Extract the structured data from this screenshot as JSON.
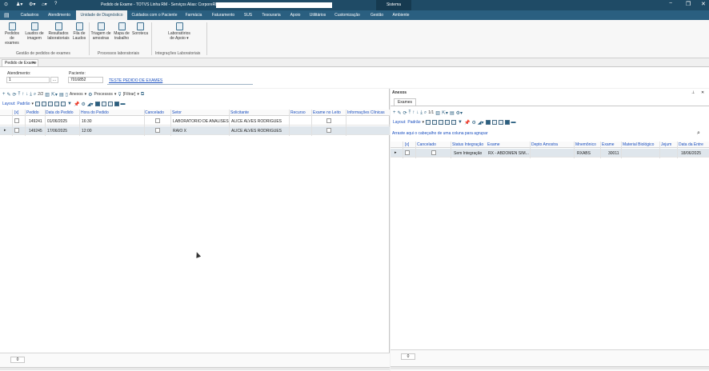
{
  "window": {
    "title": "Pedido de Exame - TOTVS Linha RM - Serviços  Alias: CorporeRM_",
    "system_tab": "Sistema",
    "controls": [
      "−",
      "❐",
      "✕"
    ]
  },
  "menu": {
    "tabs": [
      "Cadastros",
      "Atendimento",
      "Unidade de Diagnóstico",
      "Cuidados com o Paciente",
      "Farmácia",
      "Faturamento",
      "SUS",
      "Tesouraria",
      "Apoio",
      "Utilitários",
      "Customização",
      "Gestão",
      "Ambiente"
    ],
    "active": "Unidade de Diagnóstico"
  },
  "ribbon": {
    "groups": [
      {
        "label": "Gestão de pedidos de exames",
        "buttons": [
          [
            "Pedidos",
            "de exames"
          ],
          [
            "Laudos de",
            "imagem"
          ],
          [
            "Resultados",
            "laboratoriais"
          ],
          [
            "Fila de",
            "Laudos"
          ]
        ]
      },
      {
        "label": "Processos laboratoriais",
        "buttons": [
          [
            "Triagem de",
            "amostras"
          ],
          [
            "Mapa de",
            "trabalho"
          ],
          [
            "Soroteca",
            ""
          ]
        ]
      },
      {
        "label": "Integrações Laboratoriais",
        "buttons": [
          [
            "Laboratórios",
            "de Apoio ▾"
          ]
        ]
      }
    ]
  },
  "doc_tab": "Pedido de Exame",
  "fields": {
    "atendimento_label": "Atendimento:",
    "atendimento_value": "1",
    "lookup_button": "...",
    "paciente_label": "Paciente:",
    "paciente_value": "7016852",
    "paciente_name": "TESTE PEDIDO DE EXAMES"
  },
  "left_toolbar": {
    "page": "2/2",
    "anexos": "Anexos",
    "processos": "Processos",
    "filtrar": "[Filtrar]",
    "layout": "Layout:",
    "padrao": "Padrão"
  },
  "left_grid": {
    "headers": [
      "[x]",
      "Pedido",
      "Data do Pedido",
      "Hora do Pedido",
      "Cancelado",
      "Setor",
      "Solicitante",
      "Recurso",
      "Exame no Leito",
      "Informações Clínicas"
    ],
    "rows": [
      {
        "pedido": "149241",
        "data": "01/06/2025",
        "hora": "16:30",
        "setor": "LABORATÓRIO DE ANÁLISES",
        "solicitante": "ALICE ALVES RODRIGUES"
      },
      {
        "pedido": "149245",
        "data": "17/06/2025",
        "hora": "12:00",
        "setor": "RAIO X",
        "solicitante": "ALICE ALVES RODRIGUES"
      }
    ],
    "count": "0"
  },
  "right_panel": {
    "title": "Anexos",
    "tab": "Exames",
    "page": "1/1",
    "layout": "Layout:",
    "padrao": "Padrão",
    "group_hint": "Arraste aqui o cabeçalho de uma coluna para agrupar",
    "headers": [
      "[x]",
      "Cancelado",
      "Status Integração",
      "Exame",
      "Depto Amostra",
      "Mnemônico",
      "Exame",
      "Material Biológico",
      "Jejum",
      "Data da Entre"
    ],
    "rows": [
      {
        "status": "Sem Integração",
        "exame": "RX - ABDOMEN SIM...",
        "mnemonico": "RXABS",
        "codigo": "30011",
        "data": "18/06/2025"
      }
    ],
    "count": "0"
  }
}
